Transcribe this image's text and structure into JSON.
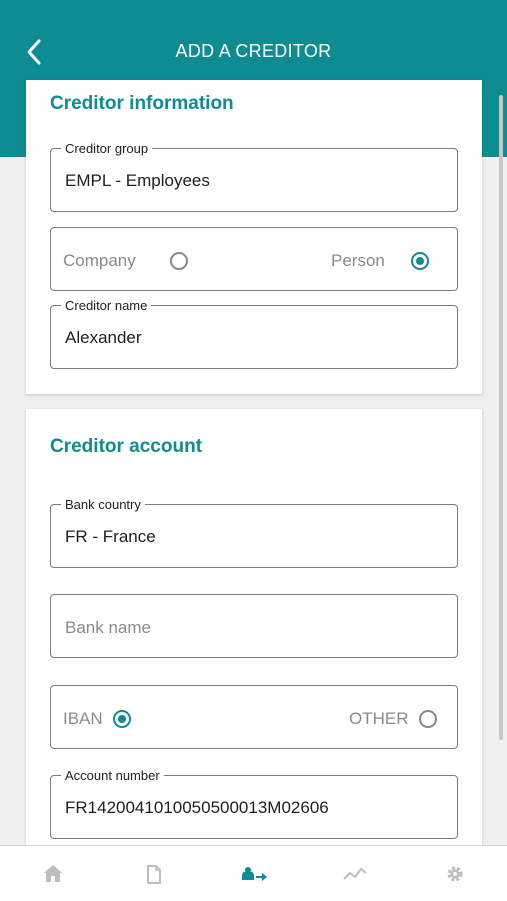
{
  "header": {
    "title": "ADD A CREDITOR",
    "background_color": "#0e8c91"
  },
  "creditor_information": {
    "title": "Creditor information",
    "creditor_group": {
      "label": "Creditor group",
      "value": "EMPL - Employees"
    },
    "type_radio": {
      "options": [
        "Company",
        "Person"
      ],
      "selected": "Person"
    },
    "creditor_name": {
      "label": "Creditor name",
      "value": "Alexander"
    }
  },
  "creditor_account": {
    "title": "Creditor account",
    "bank_country": {
      "label": "Bank country",
      "value": "FR - France"
    },
    "bank_name": {
      "placeholder": "Bank name"
    },
    "account_type_radio": {
      "options": [
        "IBAN",
        "OTHER"
      ],
      "selected": "IBAN"
    },
    "account_number": {
      "label": "Account number",
      "value": "FR1420041010050500013M02606"
    }
  },
  "bottom_nav": {
    "items": [
      "home-icon",
      "document-icon",
      "transfer-icon",
      "chart-icon",
      "gear-icon"
    ],
    "active": "transfer-icon",
    "active_color": "#0e8c91",
    "inactive_color": "#bdbdbd"
  }
}
